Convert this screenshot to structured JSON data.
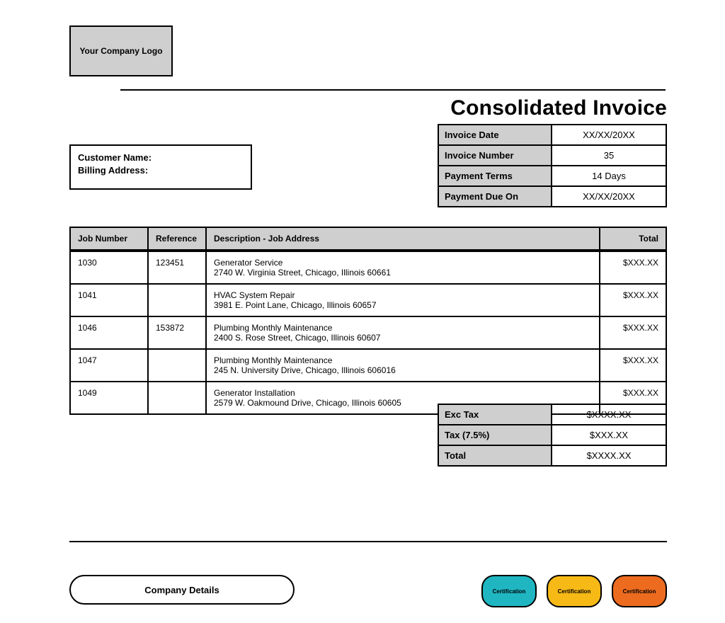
{
  "logo_text": "Your Company Logo",
  "title": "Consolidated Invoice",
  "customer": {
    "name_label": "Customer Name:",
    "billing_label": "Billing Address:"
  },
  "meta": {
    "rows": [
      {
        "label": "Invoice Date",
        "value": "XX/XX/20XX"
      },
      {
        "label": "Invoice Number",
        "value": "35"
      },
      {
        "label": "Payment Terms",
        "value": "14 Days"
      },
      {
        "label": "Payment Due On",
        "value": "XX/XX/20XX"
      }
    ]
  },
  "items": {
    "headers": {
      "job": "Job Number",
      "ref": "Reference",
      "desc": "Description - Job Address",
      "total": "Total"
    },
    "rows": [
      {
        "job": "1030",
        "ref": "123451",
        "desc": "Generator Service",
        "addr": "2740 W. Virginia Street, Chicago, Illinois 60661",
        "total": "$XXX.XX"
      },
      {
        "job": "1041",
        "ref": "",
        "desc": "HVAC System Repair",
        "addr": "3981 E. Point Lane, Chicago, Illinois 60657",
        "total": "$XXX.XX"
      },
      {
        "job": "1046",
        "ref": "153872",
        "desc": "Plumbing Monthly Maintenance",
        "addr": "2400 S. Rose Street, Chicago, Illinois 60607",
        "total": "$XXX.XX"
      },
      {
        "job": "1047",
        "ref": "",
        "desc": "Plumbing Monthly Maintenance",
        "addr": "245 N. University Drive, Chicago, Illinois 606016",
        "total": "$XXX.XX"
      },
      {
        "job": "1049",
        "ref": "",
        "desc": "Generator Installation",
        "addr": "2579 W. Oakmound Drive, Chicago, Illinois 60605",
        "total": "$XXX.XX"
      }
    ]
  },
  "summary": {
    "rows": [
      {
        "label": "Exc Tax",
        "value": "$XXXX.XX"
      },
      {
        "label": "Tax (7.5%)",
        "value": "$XXX.XX"
      },
      {
        "label": "Total",
        "value": "$XXXX.XX"
      }
    ]
  },
  "footer": {
    "company_details": "Company Details",
    "badges": [
      {
        "label": "Certification",
        "color": "teal"
      },
      {
        "label": "Certification",
        "color": "yellow"
      },
      {
        "label": "Certification",
        "color": "orange"
      }
    ]
  }
}
